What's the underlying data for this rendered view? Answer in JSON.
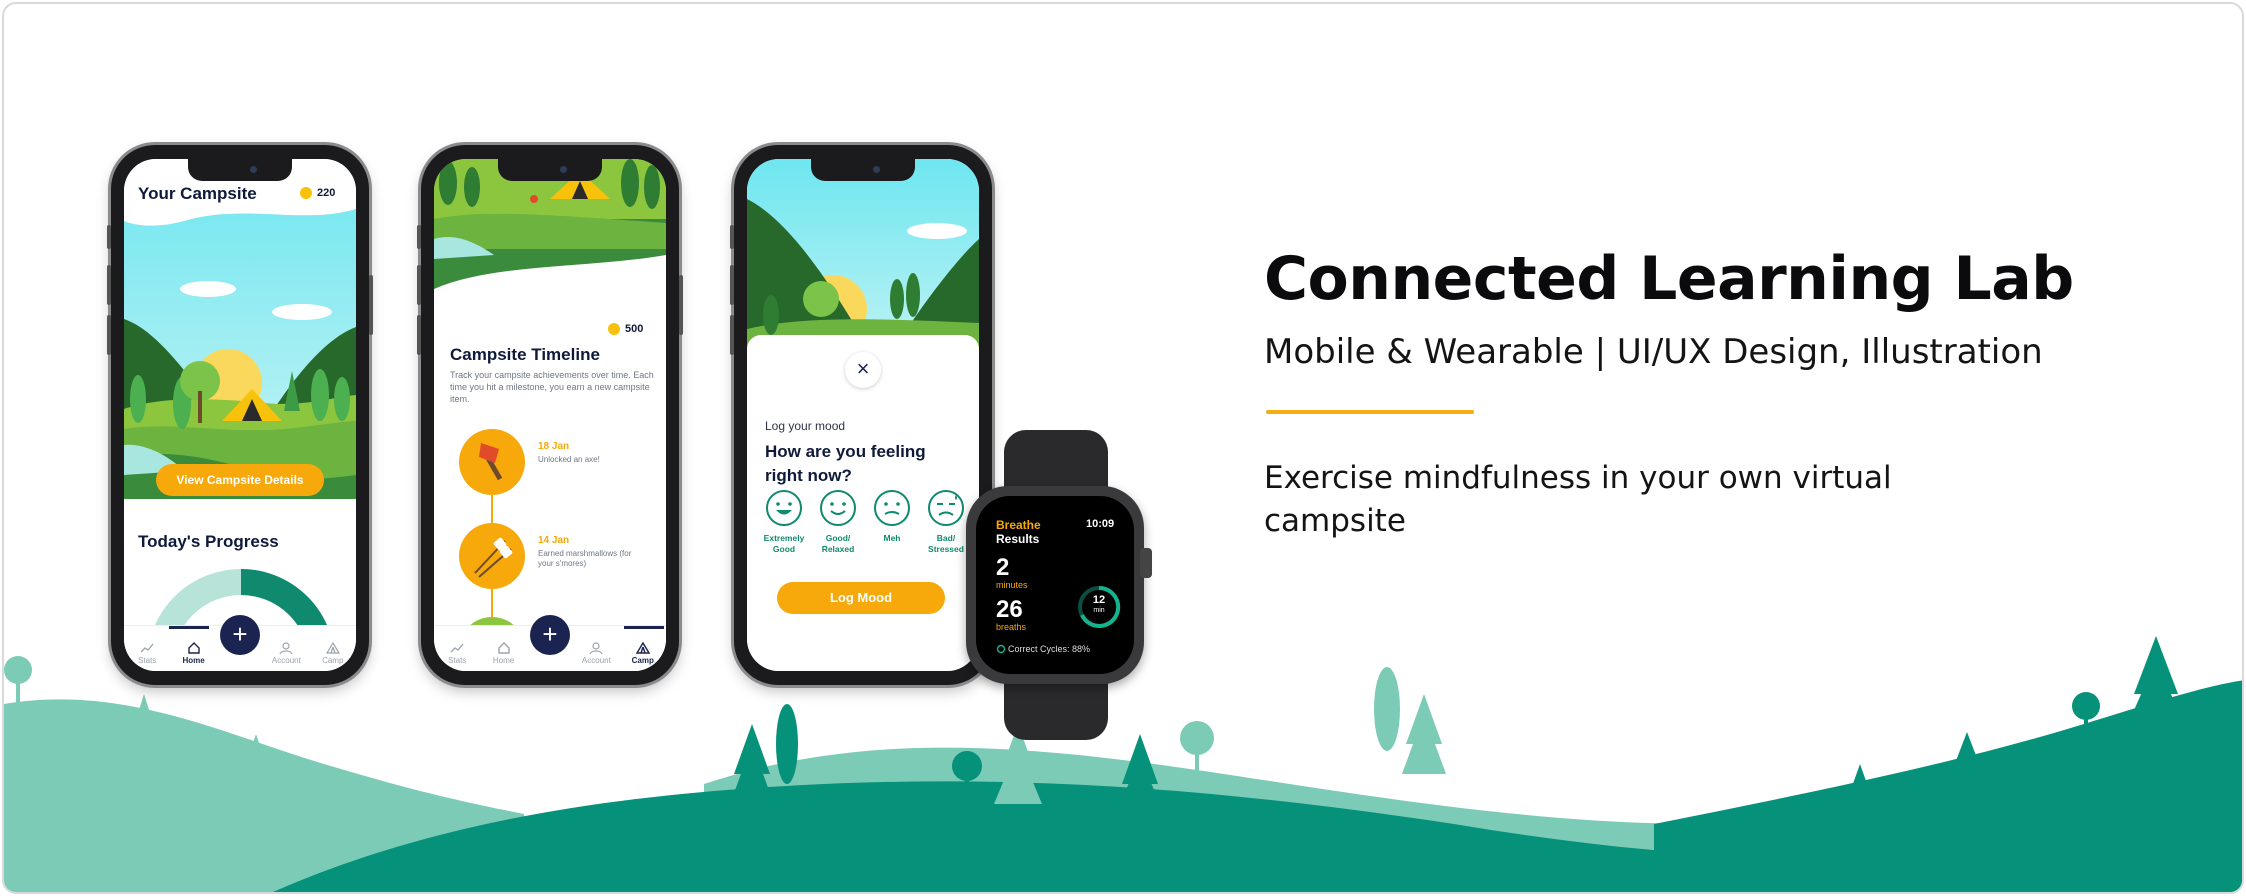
{
  "title": "Connected Learning Lab",
  "subtitle": "Mobile & Wearable | UI/UX Design, Illustration",
  "description": "Exercise mindfulness in your own virtual campsite",
  "colors": {
    "accent": "#f7a80a",
    "navy": "#1b2450",
    "green_dark": "#06917a",
    "green_light": "#7ccbb7"
  },
  "nav": {
    "stats": "Stats",
    "home": "Home",
    "account": "Account",
    "camp": "Camp",
    "add_icon": "plus-icon"
  },
  "phone1": {
    "title": "Your Campsite",
    "coins": "220",
    "button": "View Campsite Details",
    "progress_title": "Today's Progress"
  },
  "phone2": {
    "coins": "500",
    "title": "Campsite Timeline",
    "description": "Track your campsite achievements over time. Each time you hit a milestone, you earn a new campsite item.",
    "timeline": [
      {
        "date": "18 Jan",
        "text": "Unlocked an axe!"
      },
      {
        "date": "14 Jan",
        "text": "Earned marshmallows (for your s'mores)"
      }
    ]
  },
  "phone3": {
    "subtitle": "Log your mood",
    "question": "How are you feeling right now?",
    "moods": [
      "Extremely Good",
      "Good/ Relaxed",
      "Meh",
      "Bad/ Stressed"
    ],
    "button": "Log Mood"
  },
  "watch": {
    "app": "Breathe",
    "time": "10:09",
    "results": "Results",
    "minutes_value": "2",
    "minutes_label": "minutes",
    "breaths_value": "26",
    "breaths_label": "breaths",
    "ring_value": "12",
    "ring_unit": "min",
    "cycles": "Correct Cycles: 88%"
  }
}
